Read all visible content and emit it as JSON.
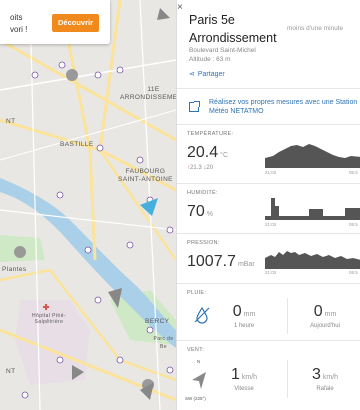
{
  "map": {
    "popup": {
      "line1": "oits",
      "line2": "vori !",
      "button": "Découvrir"
    },
    "labels": {
      "arr11": "11E\nARRONDISSEMENT",
      "bastille": "BASTILLE",
      "faubourg": "FAUBOURG\nSAINT-ANTOINE",
      "plantes": "Plantes",
      "hopital": "Hôpital Pitié-\nSalpêtrière",
      "bercy": "BERCY",
      "parc_bercy": "Parc de Be",
      "nt1": "NT",
      "nt2": "NT"
    },
    "colors": {
      "river": "#a9cfe9",
      "park": "#cfe9c6",
      "road": "#fbe39a"
    }
  },
  "panel": {
    "close": "×",
    "title": "Paris 5e Arrondissement",
    "updated": "moins d'une minute",
    "address": "Boulevard Saint-Michel",
    "altitude": "Altitude : 63 m",
    "share": "Partager",
    "measure_link": "Réalisez vos propres mesures avec une Station Météo NETATMO",
    "temperature": {
      "label": "TEMPÉRATURE:",
      "value": "20.4",
      "unit": "°C",
      "max": "21.3",
      "min": "20",
      "t1": "21:02",
      "t2": "05:5"
    },
    "humidity": {
      "label": "HUMIDITÉ:",
      "value": "70",
      "unit": "%",
      "t1": "21:02",
      "t2": "05:5"
    },
    "pressure": {
      "label": "PRESSION:",
      "value": "1007.7",
      "unit": "mBar",
      "t1": "21:02",
      "t2": "05:5"
    },
    "rain": {
      "label": "PLUIE:",
      "hour_value": "0",
      "hour_unit": "mm",
      "hour_label": "1 heure",
      "day_value": "0",
      "day_unit": "mm",
      "day_label": "Aujourd'hui"
    },
    "wind": {
      "label": "VENT:",
      "north": "N",
      "direction": "SW (225°)",
      "speed_value": "1",
      "speed_unit": "km/h",
      "speed_label": "Vitesse",
      "gust_value": "3",
      "gust_unit": "km/h",
      "gust_label": "Rafale"
    }
  }
}
